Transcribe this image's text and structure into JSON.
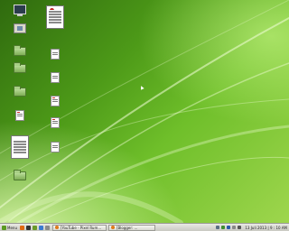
{
  "desktop": {
    "icons": [
      {
        "name": "computer-icon",
        "label": ""
      },
      {
        "name": "home-folder-icon",
        "label": ""
      },
      {
        "name": "folder-1-icon",
        "label": ""
      },
      {
        "name": "folder-2-icon",
        "label": ""
      },
      {
        "name": "folder-3-icon",
        "label": ""
      },
      {
        "name": "document-1-icon",
        "label": ""
      },
      {
        "name": "document-2-icon",
        "label": ""
      },
      {
        "name": "document-3-icon",
        "label": ""
      },
      {
        "name": "document-4-icon",
        "label": ""
      },
      {
        "name": "document-5-icon",
        "label": ""
      },
      {
        "name": "document-6-icon",
        "label": ""
      },
      {
        "name": "document-7-icon",
        "label": ""
      },
      {
        "name": "document-8-icon",
        "label": ""
      },
      {
        "name": "document-large-icon",
        "label": ""
      },
      {
        "name": "folder-4-icon",
        "label": ""
      }
    ]
  },
  "taskbar": {
    "menu_label": "Menu",
    "tasks": [
      {
        "label": "[YouTube - Pixel Rum..."
      },
      {
        "label": "[Blogger: ..."
      }
    ],
    "clock": "13 Juli 2013 | 9 : 10 AM"
  },
  "colors": {
    "desktop_dark": "#2f6a0e",
    "desktop_light": "#9ed64d",
    "taskbar": "#dcdcd6"
  }
}
